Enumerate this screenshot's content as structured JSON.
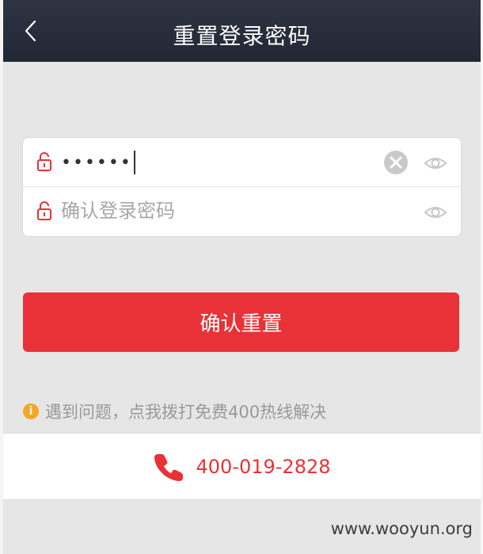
{
  "header": {
    "title": "重置登录密码",
    "back_icon": "back-chevron-icon"
  },
  "form": {
    "new_password": {
      "value": "••••••",
      "icon": "lock-icon"
    },
    "confirm_password": {
      "placeholder": "确认登录密码",
      "icon": "lock-icon"
    }
  },
  "actions": {
    "confirm_label": "确认重置"
  },
  "help": {
    "text": "遇到问题，点我拨打免费400热线解决",
    "icon": "info-icon"
  },
  "hotline": {
    "number": "400-019-2828",
    "icon": "phone-icon"
  },
  "watermark": "www.wooyun.org",
  "colors": {
    "accent": "#e83237",
    "header": "#272c3a",
    "info": "#f5a623"
  }
}
